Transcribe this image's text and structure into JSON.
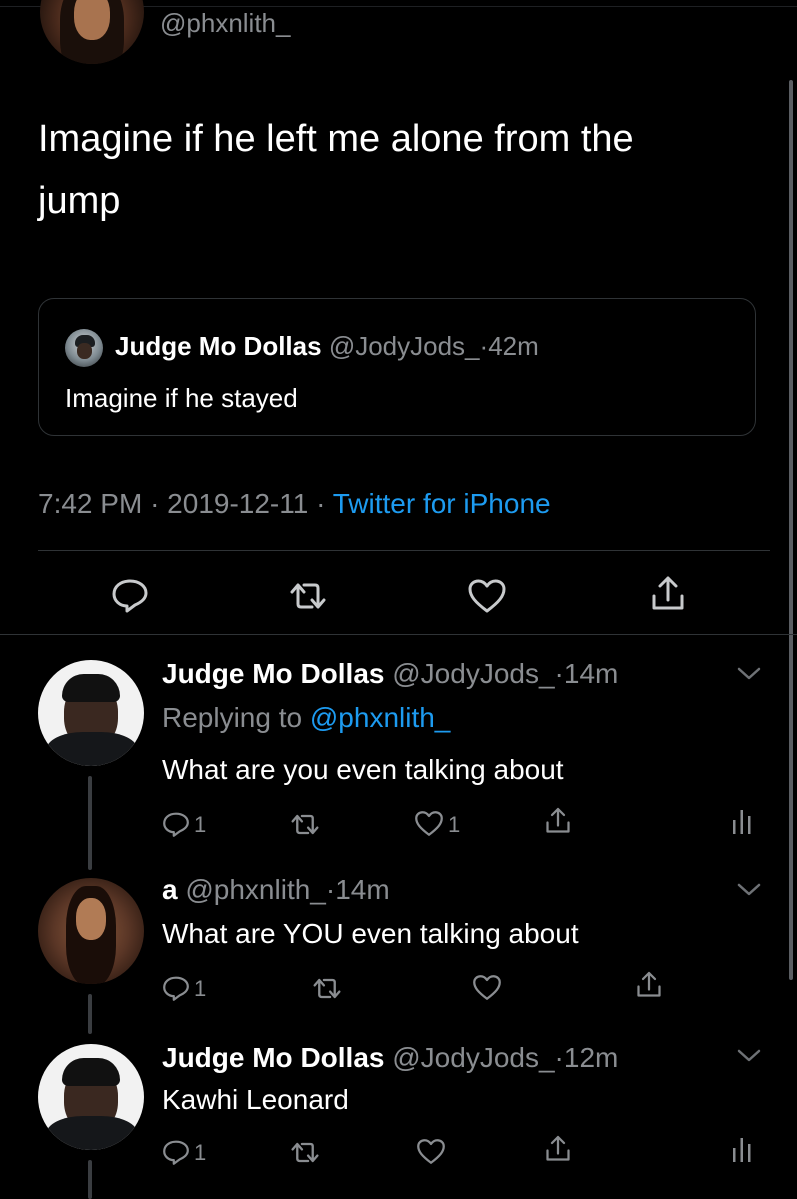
{
  "main_tweet": {
    "handle": "@phxnlith_",
    "text_line1": "Imagine if he left me alone from the",
    "text_line2": "jump",
    "quote": {
      "name": "Judge Mo Dollas",
      "handle": "@JodyJods_",
      "time": "42m",
      "text": "Imagine if he stayed"
    },
    "meta": {
      "time": "7:42 PM",
      "date": "2019-12-11",
      "source": "Twitter for iPhone"
    }
  },
  "replies": [
    {
      "name": "Judge Mo Dollas",
      "handle": "@JodyJods_",
      "time": "14m",
      "replying_prefix": "Replying to",
      "replying_to": "@phxnlith_",
      "text": "What are you even talking about",
      "reply_count": "1",
      "like_count": "1"
    },
    {
      "name": "a",
      "handle": "@phxnlith_",
      "time": "14m",
      "text": "What are YOU even talking about",
      "reply_count": "1"
    },
    {
      "name": "Judge Mo Dollas",
      "handle": "@JodyJods_",
      "time": "12m",
      "text": "Kawhi Leonard",
      "reply_count": "1"
    }
  ],
  "separator": "·",
  "colors": {
    "background": "#000000",
    "muted_text": "#8a8d91",
    "link": "#1d9bf0",
    "divider": "#2f3336"
  },
  "icons": [
    "reply-icon",
    "retweet-icon",
    "like-icon",
    "share-icon",
    "analytics-icon",
    "chevron-down-icon"
  ]
}
